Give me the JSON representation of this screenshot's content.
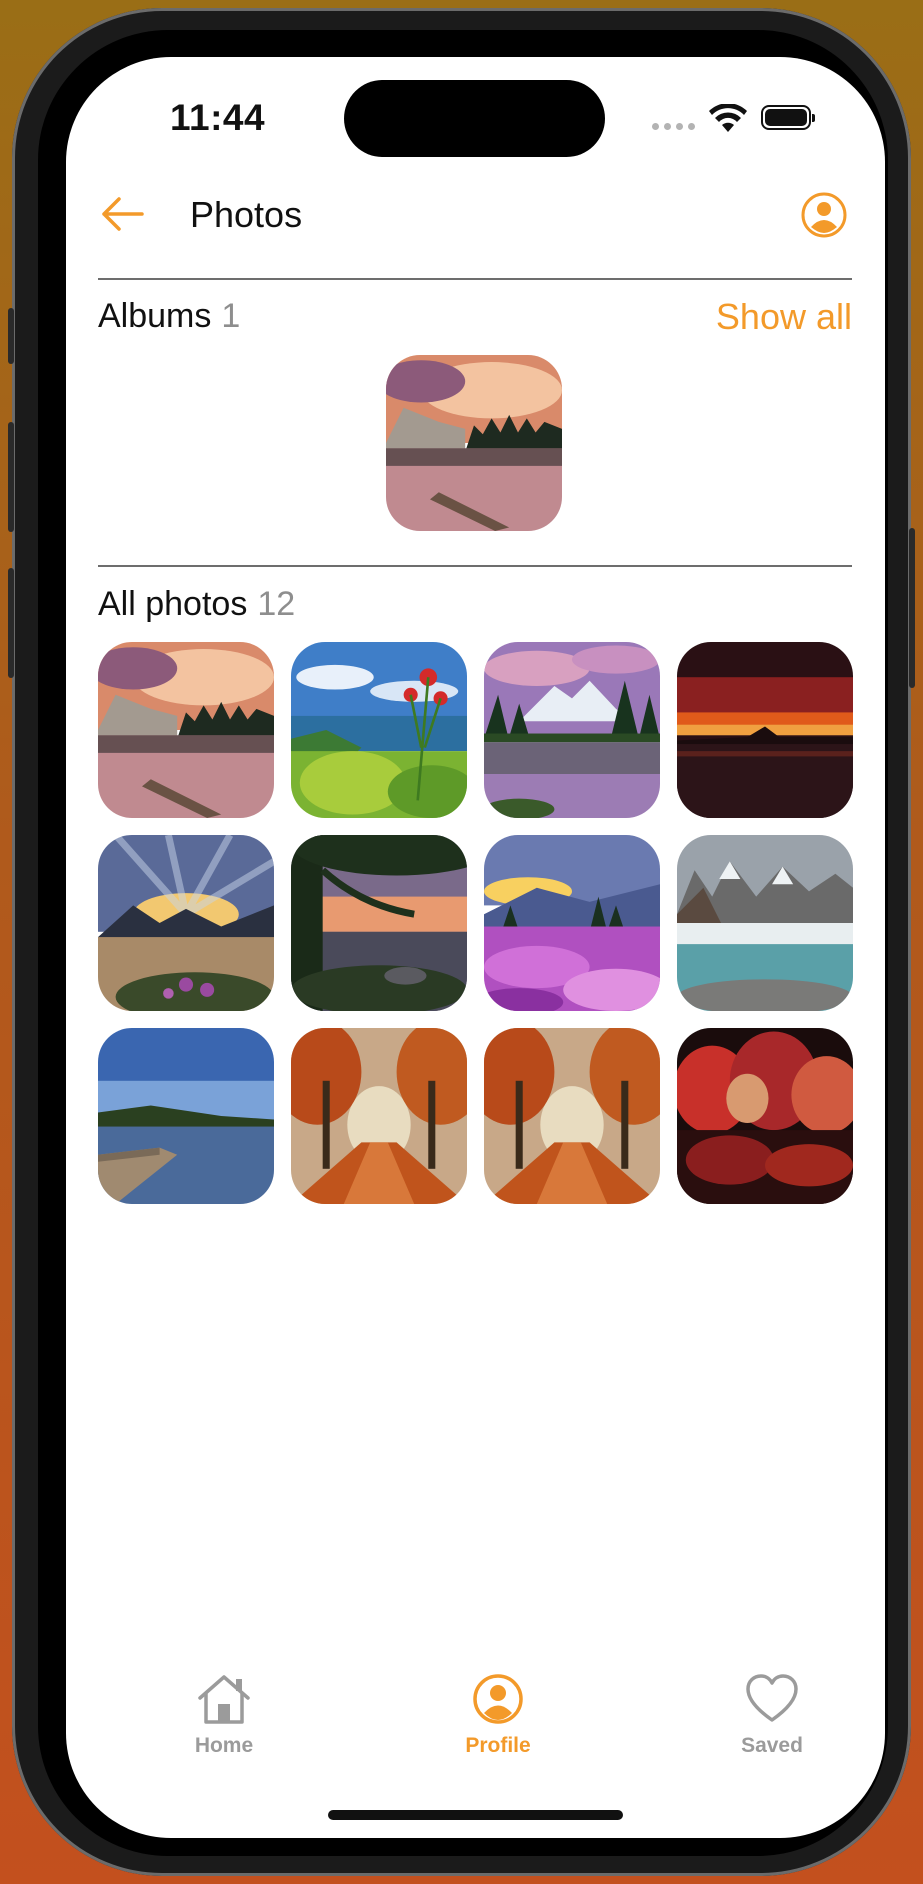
{
  "status_bar": {
    "time": "11:44"
  },
  "nav": {
    "title": "Photos",
    "back_icon": "arrow-left-icon",
    "profile_icon": "person-circle-icon"
  },
  "albums": {
    "title": "Albums",
    "count": "1",
    "show_all": "Show all"
  },
  "all_photos": {
    "title": "All photos",
    "count": "12"
  },
  "tabbar": {
    "items": [
      {
        "label": "Home",
        "icon": "house-icon",
        "active": false
      },
      {
        "label": "Profile",
        "icon": "person-circle-icon",
        "active": true
      },
      {
        "label": "Saved",
        "icon": "heart-icon",
        "active": false
      }
    ]
  },
  "colors": {
    "accent": "#F39A2A",
    "inactive": "#9B9B9B"
  }
}
